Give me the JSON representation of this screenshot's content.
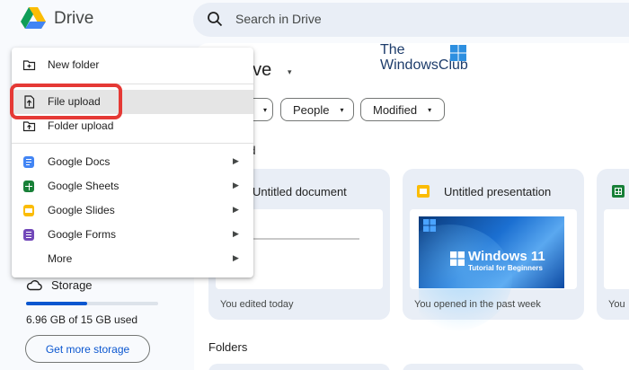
{
  "header": {
    "brand": "Drive",
    "search_placeholder": "Search in Drive"
  },
  "main": {
    "title": "rive",
    "title_caret": "▾",
    "filters": {
      "partial_caret": "▾",
      "people": "People",
      "people_caret": "▾",
      "modified": "Modified",
      "modified_caret": "▾"
    },
    "suggested_label": "ed",
    "cards": [
      {
        "title": "Untitled document",
        "footer": "You edited today",
        "icon": "docs-icon",
        "color": "#4285f4"
      },
      {
        "title": "Untitled presentation",
        "footer": "You opened in the past week",
        "icon": "slides-icon",
        "color": "#fbbc04"
      },
      {
        "title": "",
        "footer": "You",
        "icon": "sheets-icon",
        "color": "#188038"
      }
    ],
    "thumb_text": {
      "line1": "Windows 11",
      "line2": "Tutorial for Beginners"
    },
    "folders_label": "Folders"
  },
  "watermark": {
    "line1": "The",
    "line2": "WindowsClub"
  },
  "menu": {
    "items": [
      {
        "label": "New folder",
        "icon": "new-folder-icon"
      },
      {
        "label": "File upload",
        "icon": "file-upload-icon",
        "highlighted": true
      },
      {
        "label": "Folder upload",
        "icon": "folder-upload-icon"
      },
      {
        "label": "Google Docs",
        "icon": "docs-icon",
        "color": "#4285f4",
        "arrow": "▶"
      },
      {
        "label": "Google Sheets",
        "icon": "sheets-icon",
        "color": "#188038",
        "arrow": "▶"
      },
      {
        "label": "Google Slides",
        "icon": "slides-icon",
        "color": "#fbbc04",
        "arrow": "▶"
      },
      {
        "label": "Google Forms",
        "icon": "forms-icon",
        "color": "#7248b9",
        "arrow": "▶"
      },
      {
        "label": "More",
        "icon": "",
        "arrow": "▶"
      }
    ]
  },
  "storage": {
    "label": "Storage",
    "used_text": "6.96 GB of 15 GB used",
    "used_fraction": 0.464,
    "button": "Get more storage"
  },
  "colors": {
    "accent": "#0b57d0",
    "highlight_box": "#e53935"
  }
}
